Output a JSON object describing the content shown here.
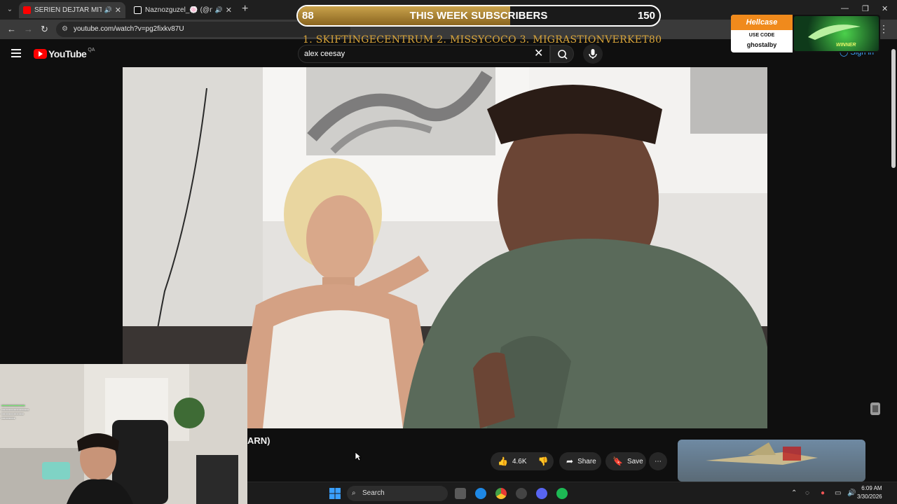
{
  "browser": {
    "tabs": [
      {
        "title": "SERIEN DEJTAR MITT EX: BA",
        "favicon_color": "#ff0000",
        "active": true
      },
      {
        "title": "Naznozguzel_🍥 (@naznoz",
        "favicon_color": "#ffffff",
        "active": false
      }
    ],
    "url": "youtube.com/watch?v=pg2fixkv87U"
  },
  "youtube": {
    "logo_word": "YouTube",
    "country_code": "QA",
    "search_value": "alex ceesay",
    "sign_in": "Sign in",
    "video_title_fragment": "ARN)",
    "likes": "4.6K",
    "share_label": "Share",
    "save_label": "Save"
  },
  "overlay": {
    "subs_current": "88",
    "subs_goal": "150",
    "subs_fraction": 0.587,
    "subs_label": "THIS WEEK SUBSCRIBERS",
    "top_subs": "1. SKIFTINGECENTRUM  2. MISSYCOCO  3. MIGRASTIONVERKET80",
    "sponsor_brand": "Hellcase",
    "sponsor_use_code": "USE CODE",
    "sponsor_code": "ghostalby",
    "sponsor_badge": "WINNER"
  },
  "taskbar": {
    "search_label": "Search",
    "time": "6:09 AM",
    "date": "3/30/2026"
  },
  "colors": {
    "youtube_red": "#ff0000",
    "link_blue": "#3ea6ff",
    "ticker_gold": "#d9a53a",
    "hellcase_orange": "#f08a1c"
  }
}
